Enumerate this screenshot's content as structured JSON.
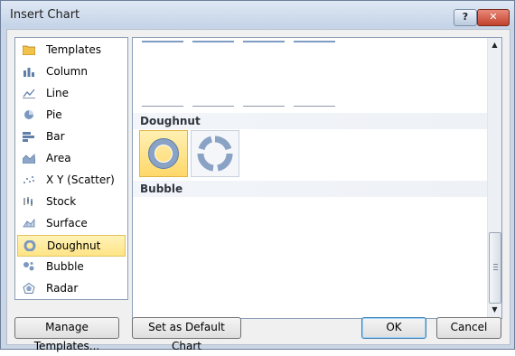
{
  "window": {
    "title": "Insert Chart",
    "help_label": "?",
    "close_label": "✕"
  },
  "chart_types": [
    {
      "label": "Templates",
      "icon": "folder-icon"
    },
    {
      "label": "Column",
      "icon": "column-chart-icon"
    },
    {
      "label": "Line",
      "icon": "line-chart-icon"
    },
    {
      "label": "Pie",
      "icon": "pie-chart-icon"
    },
    {
      "label": "Bar",
      "icon": "bar-chart-icon"
    },
    {
      "label": "Area",
      "icon": "area-chart-icon"
    },
    {
      "label": "X Y (Scatter)",
      "icon": "scatter-chart-icon"
    },
    {
      "label": "Stock",
      "icon": "stock-chart-icon"
    },
    {
      "label": "Surface",
      "icon": "surface-chart-icon"
    },
    {
      "label": "Doughnut",
      "icon": "doughnut-chart-icon",
      "selected": true
    },
    {
      "label": "Bubble",
      "icon": "bubble-chart-icon"
    },
    {
      "label": "Radar",
      "icon": "radar-chart-icon"
    }
  ],
  "gallery": {
    "sections": [
      {
        "label": "Doughnut"
      },
      {
        "label": "Bubble"
      }
    ],
    "thumbnails": [
      {
        "icon": "doughnut-icon",
        "selected": true
      },
      {
        "icon": "exploded-doughnut-icon",
        "selected": false
      }
    ]
  },
  "buttons": {
    "manage_templates": "Manage Templates...",
    "set_default": "Set as Default Chart",
    "ok": "OK",
    "cancel": "Cancel"
  },
  "colors": {
    "selection_fill": "#ffe486",
    "accent_blue": "#7f9cc4"
  }
}
